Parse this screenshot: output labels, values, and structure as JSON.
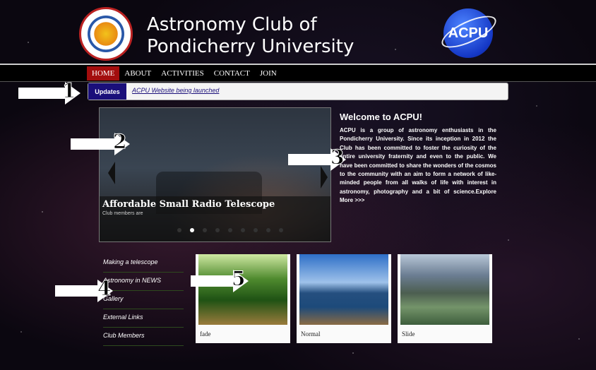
{
  "header": {
    "title_line1": "Astronomy Club of",
    "title_line2": "Pondicherry University",
    "left_logo_ring": "PONDICHERRY UNIVERSITY",
    "right_logo_text": "ACPU"
  },
  "nav": {
    "items": [
      {
        "label": "HOME",
        "active": true
      },
      {
        "label": "ABOUT",
        "active": false
      },
      {
        "label": "ACTIVITIES",
        "active": false
      },
      {
        "label": "CONTACT",
        "active": false
      },
      {
        "label": "JOIN",
        "active": false
      }
    ]
  },
  "ticker": {
    "label": "Updates",
    "text": "ACPU Website being launched"
  },
  "slider": {
    "caption_title": "Affordable Small Radio Telescope",
    "caption_sub": "Club members are",
    "dots": 9,
    "active_dot": 1
  },
  "welcome": {
    "heading": "Welcome to ACPU!",
    "body": "ACPU is a group of astronomy enthusiasts in the Pondicherry University. Since its inception in 2012 the Club has been committed to foster the curiosity of the entire university fraternity and even to the public. We have been committed to share the wonders of the cosmos to the community with an aim to form a network of like-minded people from all walks of life with interest in astronomy, photography and a bit of science.",
    "more": "Explore More >>>"
  },
  "sidebar": {
    "links": [
      "Making a telescope",
      "Astronomy in NEWS",
      "Gallery",
      "External Links",
      "Club Members"
    ]
  },
  "thumbs": [
    {
      "label": "fade"
    },
    {
      "label": "Normal"
    },
    {
      "label": "Slide"
    }
  ],
  "annotations": [
    "1",
    "2",
    "3",
    "4",
    "5"
  ]
}
